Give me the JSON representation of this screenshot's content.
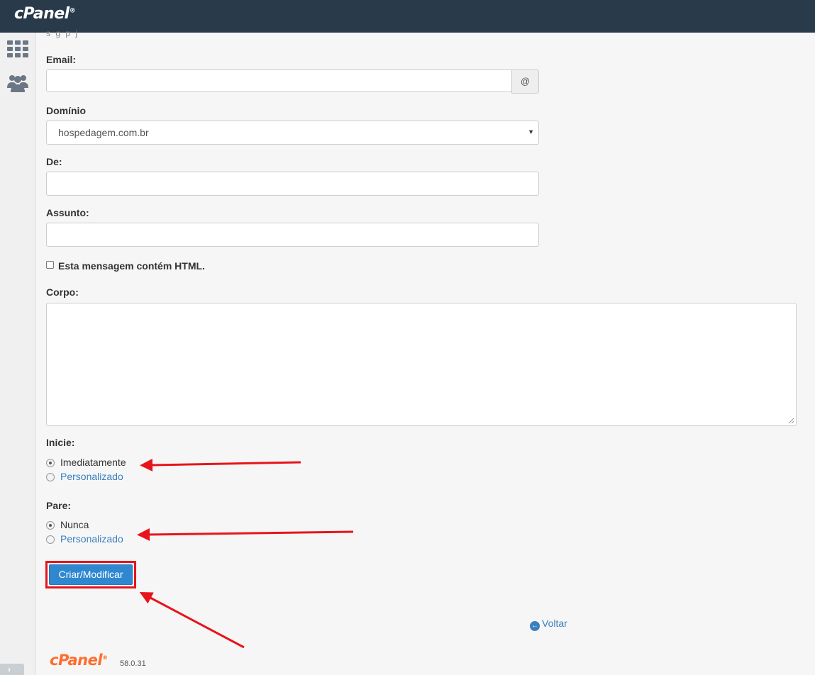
{
  "header": {
    "logo": "cPanel"
  },
  "sidebar": {
    "icons": [
      "grid-icon",
      "users-icon"
    ]
  },
  "form": {
    "cut_text": "s   g          p            j",
    "email_label": "Email:",
    "email_value": "",
    "email_addon": "@",
    "domain_label": "Domínio",
    "domain_value": "hospedagem.com.br",
    "from_label": "De:",
    "from_value": "",
    "subject_label": "Assunto:",
    "subject_value": "",
    "html_checkbox_label": "Esta mensagem contém HTML.",
    "html_checked": false,
    "body_label": "Corpo:",
    "body_value": "",
    "start_label": "Inicie:",
    "start_options": [
      {
        "label": "Imediatamente",
        "checked": true
      },
      {
        "label": "Personalizado",
        "checked": false
      }
    ],
    "stop_label": "Pare:",
    "stop_options": [
      {
        "label": "Nunca",
        "checked": true
      },
      {
        "label": "Personalizado",
        "checked": false
      }
    ],
    "submit_label": "Criar/Modificar"
  },
  "back_link": "Voltar",
  "footer": {
    "logo": "cPanel",
    "version": "58.0.31"
  },
  "colors": {
    "topbar": "#293a4a",
    "primary_button": "#2f87d0",
    "link": "#3a7fbf",
    "annotation": "#e8141b",
    "footer_logo": "#ff6c2c"
  }
}
